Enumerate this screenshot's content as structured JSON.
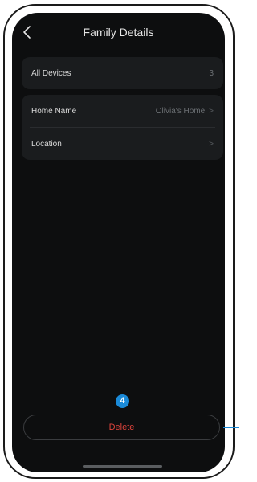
{
  "header": {
    "title": "Family Details",
    "back_icon": "chevron-left-icon"
  },
  "devices_card": {
    "label": "All Devices",
    "count": "3"
  },
  "info_card": {
    "rows": [
      {
        "label": "Home Name",
        "value": "Olivia's Home",
        "chevron": ">"
      },
      {
        "label": "Location",
        "value": "",
        "chevron": ">"
      }
    ]
  },
  "annotation": {
    "step_number": "4",
    "color": "#1a8ad8"
  },
  "actions": {
    "delete_label": "Delete",
    "delete_color": "#e0443c"
  }
}
